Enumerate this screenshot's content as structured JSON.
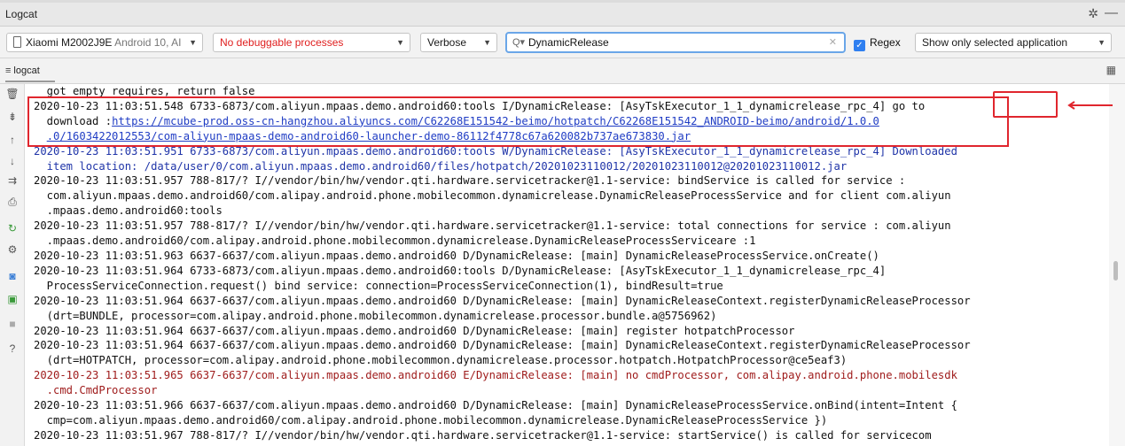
{
  "window": {
    "title": "Logcat"
  },
  "toolbar": {
    "device": {
      "name": "Xiaomi M2002J9E",
      "detail": "Android 10, AI"
    },
    "process": "No debuggable processes",
    "log_level": "Verbose",
    "search": {
      "value": "DynamicRelease"
    },
    "regex": {
      "label": "Regex",
      "checked": true
    },
    "filter": "Show only selected application"
  },
  "tab": {
    "label": "logcat"
  },
  "colors": {
    "accent": "#2f7ff0",
    "highlight": "#e0262e",
    "error": "#9e1a1a",
    "warning": "#1f34a8"
  },
  "log_lines": [
    {
      "level": "I",
      "text": "  got empty requires, return false"
    },
    {
      "level": "I",
      "text": "2020-10-23 11:03:51.548 6733-6873/com.aliyun.mpaas.demo.android60:tools I/DynamicRelease: [AsyTskExecutor_1_1_dynamicrelease_rpc_4] go to"
    },
    {
      "level": "I",
      "text": "  download :",
      "url": "https://mcube-prod.oss-cn-hangzhou.aliyuncs.com/C62268E151542-beimo/hotpatch/C62268E151542_ANDROID-beimo/android/1.0.0"
    },
    {
      "level": "I",
      "text": "  ",
      "url": ".0/1603422012553/com-aliyun-mpaas-demo-android60-launcher-demo-86112f4778c67a620082b737ae673830.jar"
    },
    {
      "level": "W",
      "text": "2020-10-23 11:03:51.951 6733-6873/com.aliyun.mpaas.demo.android60:tools W/DynamicRelease: [AsyTskExecutor_1_1_dynamicrelease_rpc_4] Downloaded"
    },
    {
      "level": "W",
      "text": "  item location: /data/user/0/com.aliyun.mpaas.demo.android60/files/hotpatch/20201023110012/20201023110012@20201023110012.jar"
    },
    {
      "level": "I",
      "text": "2020-10-23 11:03:51.957 788-817/? I//vendor/bin/hw/vendor.qti.hardware.servicetracker@1.1-service: bindService is called for service :"
    },
    {
      "level": "I",
      "text": "  com.aliyun.mpaas.demo.android60/com.alipay.android.phone.mobilecommon.dynamicrelease.DynamicReleaseProcessService and for client com.aliyun"
    },
    {
      "level": "I",
      "text": "  .mpaas.demo.android60:tools"
    },
    {
      "level": "I",
      "text": "2020-10-23 11:03:51.957 788-817/? I//vendor/bin/hw/vendor.qti.hardware.servicetracker@1.1-service: total connections for service : com.aliyun"
    },
    {
      "level": "I",
      "text": "  .mpaas.demo.android60/com.alipay.android.phone.mobilecommon.dynamicrelease.DynamicReleaseProcessServiceare :1"
    },
    {
      "level": "D",
      "text": "2020-10-23 11:03:51.963 6637-6637/com.aliyun.mpaas.demo.android60 D/DynamicRelease: [main] DynamicReleaseProcessService.onCreate()"
    },
    {
      "level": "D",
      "text": "2020-10-23 11:03:51.964 6733-6873/com.aliyun.mpaas.demo.android60:tools D/DynamicRelease: [AsyTskExecutor_1_1_dynamicrelease_rpc_4]"
    },
    {
      "level": "D",
      "text": "  ProcessServiceConnection.request() bind service: connection=ProcessServiceConnection(1), bindResult=true"
    },
    {
      "level": "D",
      "text": "2020-10-23 11:03:51.964 6637-6637/com.aliyun.mpaas.demo.android60 D/DynamicRelease: [main] DynamicReleaseContext.registerDynamicReleaseProcessor"
    },
    {
      "level": "D",
      "text": "  (drt=BUNDLE, processor=com.alipay.android.phone.mobilecommon.dynamicrelease.processor.bundle.a@5756962)"
    },
    {
      "level": "D",
      "text": "2020-10-23 11:03:51.964 6637-6637/com.aliyun.mpaas.demo.android60 D/DynamicRelease: [main] register hotpatchProcessor"
    },
    {
      "level": "D",
      "text": "2020-10-23 11:03:51.964 6637-6637/com.aliyun.mpaas.demo.android60 D/DynamicRelease: [main] DynamicReleaseContext.registerDynamicReleaseProcessor"
    },
    {
      "level": "D",
      "text": "  (drt=HOTPATCH, processor=com.alipay.android.phone.mobilecommon.dynamicrelease.processor.hotpatch.HotpatchProcessor@ce5eaf3)"
    },
    {
      "level": "E",
      "text": "2020-10-23 11:03:51.965 6637-6637/com.aliyun.mpaas.demo.android60 E/DynamicRelease: [main] no cmdProcessor, com.alipay.android.phone.mobilesdk"
    },
    {
      "level": "E",
      "text": "  .cmd.CmdProcessor"
    },
    {
      "level": "D",
      "text": "2020-10-23 11:03:51.966 6637-6637/com.aliyun.mpaas.demo.android60 D/DynamicRelease: [main] DynamicReleaseProcessService.onBind(intent=Intent {"
    },
    {
      "level": "D",
      "text": "  cmp=com.aliyun.mpaas.demo.android60/com.alipay.android.phone.mobilecommon.dynamicrelease.DynamicReleaseProcessService })"
    },
    {
      "level": "I",
      "text": "2020-10-23 11:03:51.967 788-817/? I//vendor/bin/hw/vendor.qti.hardware.servicetracker@1.1-service: startService() is called for servicecom"
    }
  ],
  "sidebar_icons": [
    "trash-icon",
    "scroll-end-icon",
    "up-arrow-icon",
    "down-arrow-icon",
    "soft-wrap-icon",
    "print-icon",
    "restart-icon",
    "settings-icon",
    "screenshot-icon",
    "screen-record-icon",
    "stop-icon",
    "help-icon"
  ]
}
